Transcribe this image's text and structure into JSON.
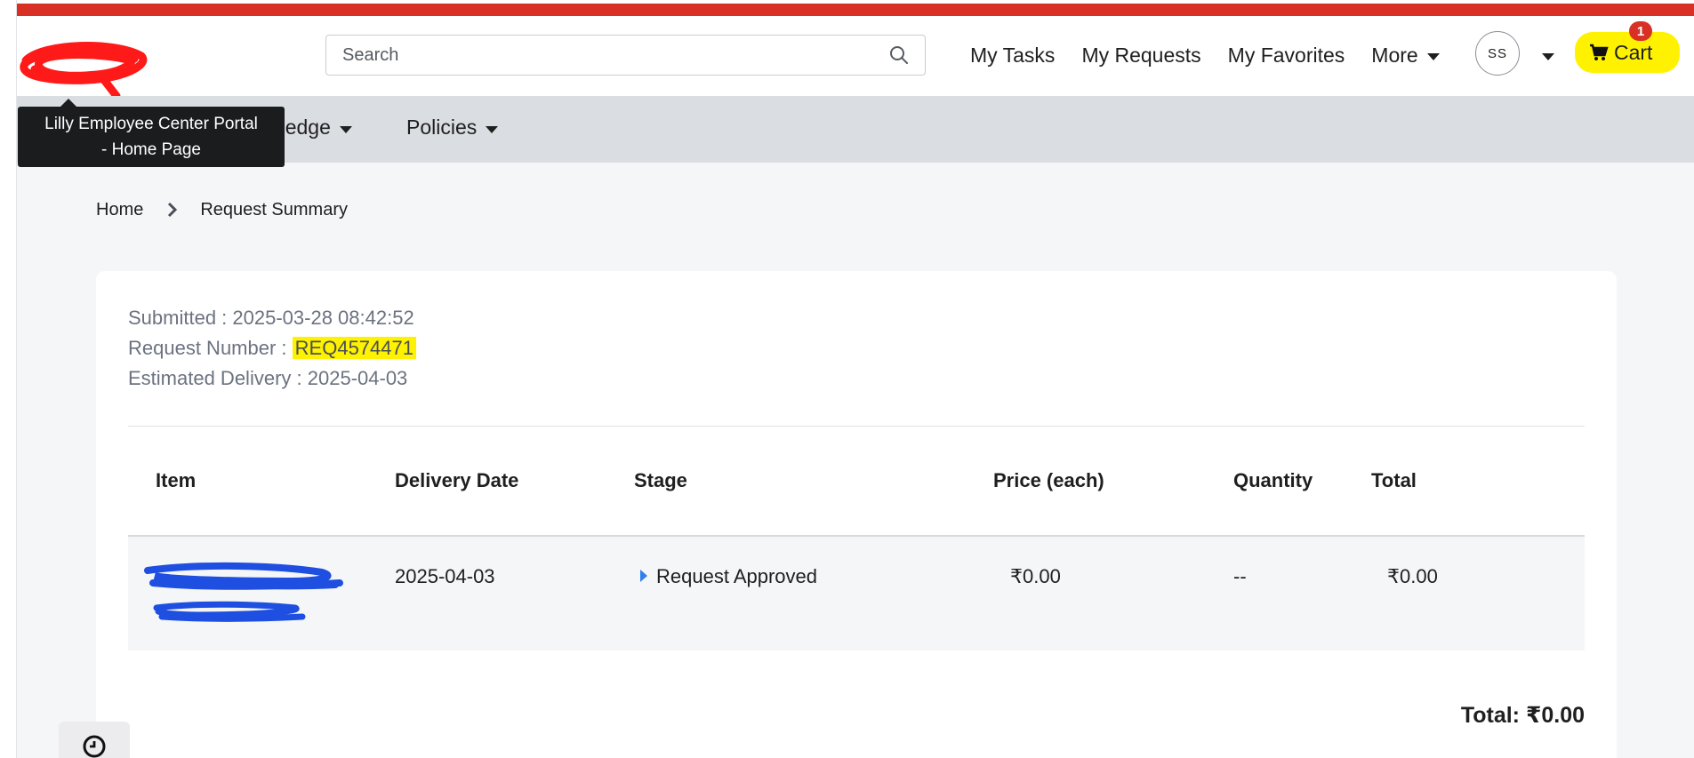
{
  "header": {
    "search_placeholder": "Search",
    "nav": {
      "my_tasks": "My Tasks",
      "my_requests": "My Requests",
      "my_favorites": "My Favorites",
      "more": "More"
    },
    "avatar_initials": "SS",
    "cart_label": "Cart",
    "cart_count": "1"
  },
  "tooltip": {
    "line1": "Lilly Employee Center Portal",
    "line2": "- Home Page"
  },
  "subnav": {
    "knowledge": "wledge",
    "policies": "Policies"
  },
  "breadcrumb": {
    "home": "Home",
    "current": "Request Summary"
  },
  "summary": {
    "submitted_label": "Submitted :",
    "submitted_value": "2025-03-28 08:42:52",
    "request_number_label": "Request Number :",
    "request_number_value": "REQ4574471",
    "estimated_delivery_label": "Estimated Delivery :",
    "estimated_delivery_value": "2025-04-03"
  },
  "table": {
    "headers": {
      "item": "Item",
      "delivery_date": "Delivery Date",
      "stage": "Stage",
      "price": "Price (each)",
      "quantity": "Quantity",
      "total": "Total"
    },
    "rows": [
      {
        "delivery_date": "2025-04-03",
        "stage": "Request Approved",
        "price": "₹0.00",
        "quantity": "--",
        "total": "₹0.00"
      }
    ]
  },
  "grand_total": "Total: ₹0.00",
  "colors": {
    "accent_red": "#d93025",
    "highlight_yellow": "#fff200",
    "stage_blue": "#2f80ed",
    "link_blue": "#1f4fe0"
  },
  "icons": [
    "logo-redacted",
    "search-icon",
    "chevron-down-icon",
    "cart-icon",
    "chevron-right-icon",
    "caret-right-icon",
    "clock-icon"
  ]
}
